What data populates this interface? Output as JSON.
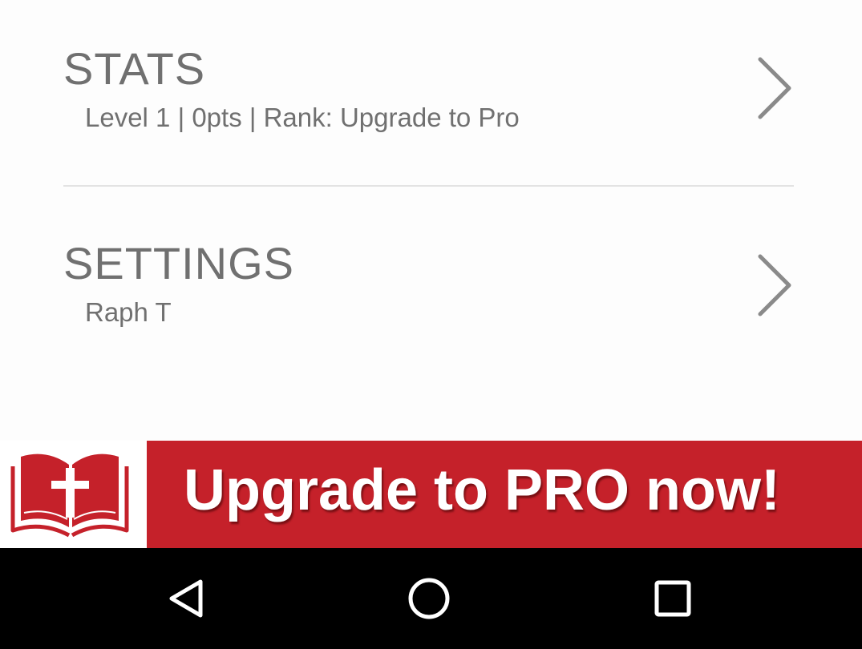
{
  "menu": {
    "stats": {
      "title": "STATS",
      "subtitle": "Level 1 | 0pts | Rank: Upgrade to Pro",
      "icon": "chevron-right-icon"
    },
    "settings": {
      "title": "SETTINGS",
      "subtitle": "Raph T",
      "icon": "chevron-right-icon"
    }
  },
  "banner": {
    "text": "Upgrade to PRO now!",
    "logo_icon": "open-bible-cross-icon",
    "accent_color": "#c5212a"
  },
  "nav_bar": {
    "back_icon": "back-triangle-icon",
    "home_icon": "home-circle-icon",
    "recents_icon": "recents-square-icon"
  }
}
